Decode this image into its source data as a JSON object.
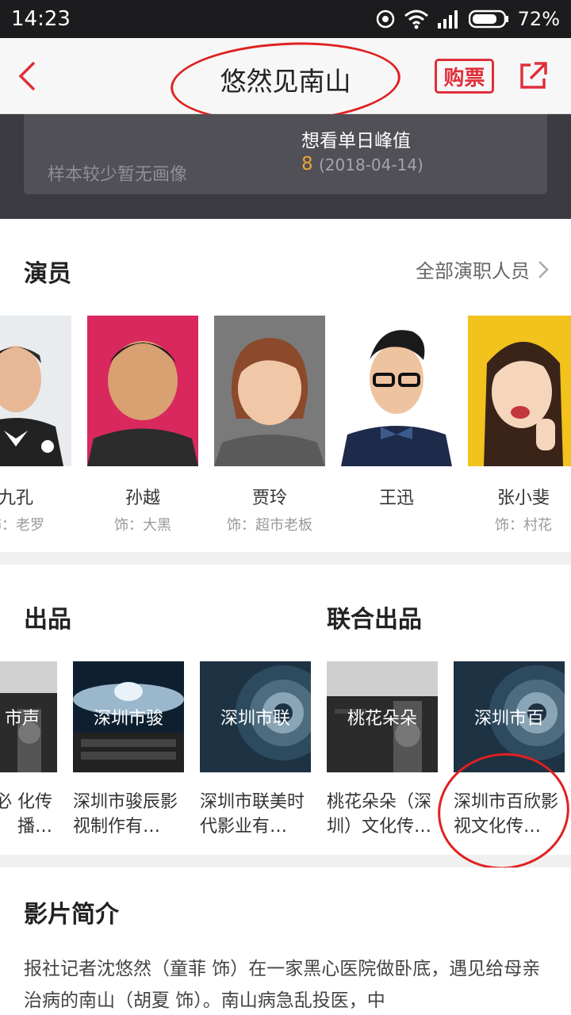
{
  "status_bar": {
    "time": "14:23",
    "battery": "72%"
  },
  "nav": {
    "title": "悠然见南山",
    "buy_label": "购票"
  },
  "stats": {
    "no_portrait": "样本较少暂无画像",
    "peak_label": "想看单日峰值",
    "peak_value": "8",
    "peak_date": "(2018-04-14)"
  },
  "actors": {
    "heading": "演员",
    "all_crew_label": "全部演职人员",
    "items": [
      {
        "name": "九孔",
        "role": "饰：老罗"
      },
      {
        "name": "孙越",
        "role": "饰：大黑"
      },
      {
        "name": "贾玲",
        "role": "饰：超市老板"
      },
      {
        "name": "王迅",
        "role": ""
      },
      {
        "name": "张小斐",
        "role": "饰：村花"
      }
    ]
  },
  "producers": {
    "heading": "出品",
    "co_heading": "联合出品",
    "items": [
      {
        "thumb": "市声",
        "name": "声必 化传播…"
      },
      {
        "thumb": "深圳市骏",
        "name": "深圳市骏辰影视制作有…"
      },
      {
        "thumb": "深圳市联",
        "name": "深圳市联美时代影业有…"
      },
      {
        "thumb": "桃花朵朵",
        "name": "桃花朵朵（深圳）文化传…"
      },
      {
        "thumb": "深圳市百",
        "name": "深圳市百欣影视文化传…"
      }
    ]
  },
  "synopsis": {
    "heading": "影片简介",
    "text": "报社记者沈悠然（童菲 饰）在一家黑心医院做卧底，遇见给母亲治病的南山（胡夏 饰）。南山病急乱投医，中"
  },
  "colors": {
    "accent": "#e0303a",
    "highlight": "#e8a43a",
    "dark_bg": "#3b3b41"
  }
}
